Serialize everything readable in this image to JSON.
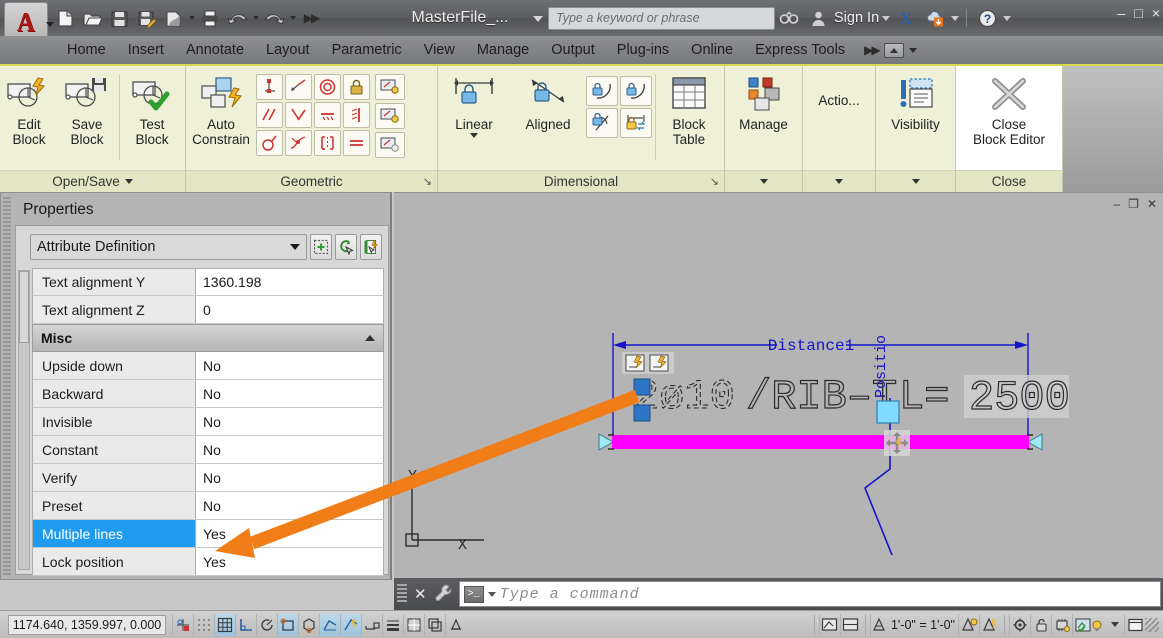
{
  "titlebar": {
    "logo_letter": "A",
    "document_title": "MasterFile_...",
    "search_placeholder": "Type a keyword or phrase",
    "sign_in_label": "Sign In",
    "quick_access": [
      {
        "name": "new-file-icon",
        "label": "New"
      },
      {
        "name": "open-file-icon",
        "label": "Open"
      },
      {
        "name": "save-icon",
        "label": "Save"
      },
      {
        "name": "save-as-icon",
        "label": "Save As"
      },
      {
        "name": "plot-preview-icon",
        "label": "Plot Preview"
      },
      {
        "name": "print-icon",
        "label": "Plot"
      },
      {
        "name": "undo-icon",
        "label": "Undo"
      },
      {
        "name": "redo-icon",
        "label": "Redo"
      },
      {
        "name": "more-commands-icon",
        "label": "More"
      }
    ],
    "window_buttons": [
      "–",
      "□",
      "×"
    ]
  },
  "ribbon_tabs": [
    {
      "label": "Home",
      "active": false
    },
    {
      "label": "Insert",
      "active": false
    },
    {
      "label": "Annotate",
      "active": false
    },
    {
      "label": "Layout",
      "active": false
    },
    {
      "label": "Parametric",
      "active": false
    },
    {
      "label": "View",
      "active": false
    },
    {
      "label": "Manage",
      "active": false
    },
    {
      "label": "Output",
      "active": false
    },
    {
      "label": "Plug-ins",
      "active": false
    },
    {
      "label": "Online",
      "active": false
    },
    {
      "label": "Express Tools",
      "active": false
    }
  ],
  "ribbon_panels": {
    "open_save": {
      "label": "Open/Save",
      "buttons": [
        {
          "line1": "Edit",
          "line2": "Block",
          "icon": "edit-block-icon"
        },
        {
          "line1": "Save",
          "line2": "Block",
          "icon": "save-block-icon"
        },
        {
          "line1": "Test",
          "line2": "Block",
          "icon": "test-block-icon"
        }
      ]
    },
    "geometric": {
      "label": "Geometric",
      "auto_constrain": {
        "line1": "Auto",
        "line2": "Constrain",
        "icon": "auto-constrain-icon"
      },
      "constraints": [
        "coincident-constraint-icon",
        "collinear-constraint-icon",
        "concentric-constraint-icon",
        "fix-constraint-icon",
        "parallel-constraint-icon",
        "perpendicular-constraint-icon",
        "horizontal-constraint-icon",
        "vertical-constraint-icon",
        "tangent-constraint-icon",
        "smooth-constraint-icon",
        "symmetric-constraint-icon",
        "equal-constraint-icon"
      ],
      "side_buttons": [
        "show-constraints-icon",
        "show-all-constraints-icon",
        "hide-all-constraints-icon"
      ]
    },
    "dimensional": {
      "label": "Dimensional",
      "linear": {
        "label": "Linear",
        "icon": "linear-constraint-icon"
      },
      "aligned": {
        "label": "Aligned",
        "icon": "aligned-constraint-icon"
      },
      "small_buttons": [
        "angular-constraint-icon",
        "radial-constraint-icon",
        "diameter-constraint-icon",
        "convert-constraint-icon"
      ],
      "block_table": {
        "line1": "Block",
        "line2": "Table",
        "icon": "block-table-icon"
      }
    },
    "manage": {
      "label": "Manage",
      "button": "Manage",
      "icon": "manage-icon"
    },
    "action": {
      "label": "Action",
      "button": "Actio...",
      "icon": "action-icon"
    },
    "visibility": {
      "label": "Visibility",
      "button": "Visibility",
      "icon": "visibility-icon"
    },
    "close": {
      "label": "Close",
      "button": {
        "line1": "Close",
        "line2": "Block Editor",
        "icon": "close-block-editor-icon"
      }
    }
  },
  "properties_palette": {
    "title": "Properties",
    "object_type": "Attribute Definition",
    "toolbar_buttons": [
      {
        "name": "quick-select-icon"
      },
      {
        "name": "select-objects-icon"
      },
      {
        "name": "quick-properties-icon"
      }
    ],
    "rows_top": [
      {
        "key": "Text alignment Y",
        "value": "1360.198",
        "selected": false
      },
      {
        "key": "Text alignment Z",
        "value": "0",
        "selected": false
      }
    ],
    "category": "Misc",
    "rows_misc": [
      {
        "key": "Upside down",
        "value": "No",
        "selected": false
      },
      {
        "key": "Backward",
        "value": "No",
        "selected": false
      },
      {
        "key": "Invisible",
        "value": "No",
        "selected": false
      },
      {
        "key": "Constant",
        "value": "No",
        "selected": false
      },
      {
        "key": "Verify",
        "value": "No",
        "selected": false
      },
      {
        "key": "Preset",
        "value": "No",
        "selected": false
      },
      {
        "key": "Multiple lines",
        "value": "Yes",
        "selected": true
      },
      {
        "key": "Lock position",
        "value": "Yes",
        "selected": false
      }
    ]
  },
  "drawing": {
    "window_buttons": [
      "–",
      "❐",
      "✕"
    ],
    "dimension_label": "Distance1",
    "parameter_label": "Positio",
    "attribute_text": "2ø10 /RIB–T L=2500",
    "attribute_prefix": "2ø10",
    "attribute_mid": "/RIB–T",
    "attribute_suffix": "L=",
    "attribute_value": "2500",
    "ucs_x_label": "X",
    "ucs_y_label": "Y",
    "colors": {
      "dimension": "#1414cc",
      "stretch_bar": "#ff00ff",
      "grip": "#2e75c8",
      "highlight_grip": "#7fdbff",
      "annotation_arrow": "#f07d18",
      "canvas_bg": "#b4b4b4"
    }
  },
  "command_line": {
    "placeholder": "Type a command",
    "close_label": "✕",
    "prompt_symbol": ">_"
  },
  "status_bar": {
    "coordinates": "1174.640, 1359.997, 0.000",
    "annotation_scale": "1'-0\" = 1'-0\"",
    "left_toggles": [
      {
        "name": "infer-constraints-icon",
        "on": false
      },
      {
        "name": "snap-mode-icon",
        "on": false
      },
      {
        "name": "grid-display-icon",
        "on": true
      },
      {
        "name": "ortho-mode-icon",
        "on": false
      },
      {
        "name": "polar-tracking-icon",
        "on": false
      },
      {
        "name": "object-snap-icon",
        "on": true
      },
      {
        "name": "3d-object-snap-icon",
        "on": false
      },
      {
        "name": "object-snap-tracking-icon",
        "on": true
      },
      {
        "name": "dynamic-ucs-icon",
        "on": true
      },
      {
        "name": "dynamic-input-icon",
        "on": false
      },
      {
        "name": "lineweight-icon",
        "on": false
      },
      {
        "name": "transparency-icon",
        "on": false
      },
      {
        "name": "selection-cycling-icon",
        "on": false
      },
      {
        "name": "annotation-monitor-icon",
        "on": false
      }
    ],
    "right_toggles": [
      {
        "name": "model-space-icon",
        "on": false
      },
      {
        "name": "quick-view-layouts-icon",
        "on": false
      },
      {
        "name": "annotation-visibility-icon",
        "on": false
      },
      {
        "name": "auto-scale-icon",
        "on": false
      },
      {
        "name": "workspace-switching-icon",
        "on": false
      },
      {
        "name": "toolbar-lock-icon",
        "on": false
      },
      {
        "name": "hardware-accel-icon",
        "on": false
      },
      {
        "name": "isolate-objects-icon",
        "on": false
      },
      {
        "name": "clean-screen-icon",
        "on": false
      }
    ]
  }
}
